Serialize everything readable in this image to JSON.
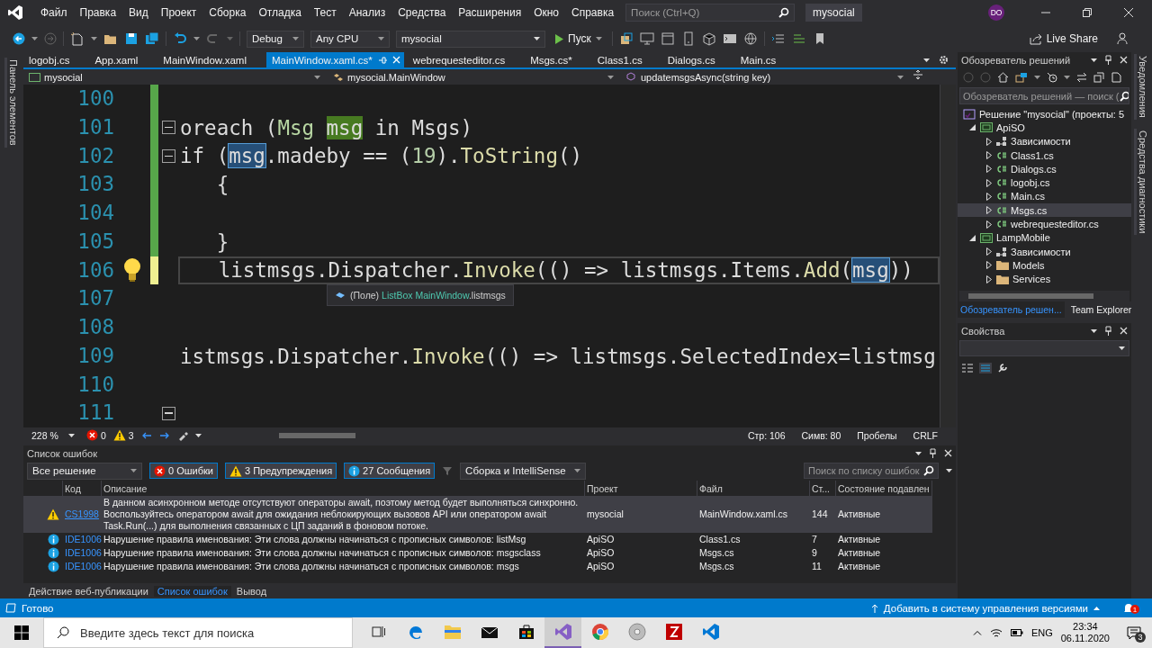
{
  "menu": [
    "Файл",
    "Правка",
    "Вид",
    "Проект",
    "Сборка",
    "Отладка",
    "Тест",
    "Анализ",
    "Средства",
    "Расширения",
    "Окно",
    "Справка"
  ],
  "search": {
    "placeholder": "Поиск (Ctrl+Q)"
  },
  "solution_name": "mysocial",
  "avatar": "DO",
  "toolbar": {
    "configuration": "Debug",
    "platform": "Any CPU",
    "startup_project": "mysocial",
    "run": "Пуск",
    "live_share": "Live Share"
  },
  "toolbox_tab": "Панель элементов",
  "doc_tabs": [
    {
      "label": "logobj.cs",
      "selected": false
    },
    {
      "label": "App.xaml",
      "selected": false
    },
    {
      "label": "MainWindow.xaml",
      "selected": false
    },
    {
      "label": "MainWindow.xaml.cs*",
      "selected": true
    },
    {
      "label": "webrequesteditor.cs",
      "selected": false
    },
    {
      "label": "Msgs.cs*",
      "selected": false
    },
    {
      "label": "Class1.cs",
      "selected": false
    },
    {
      "label": "Dialogs.cs",
      "selected": false
    },
    {
      "label": "Main.cs",
      "selected": false
    }
  ],
  "nav_bar": {
    "project": "mysocial",
    "type": "mysocial.MainWindow",
    "member": "updatemsgsAsync(string key)"
  },
  "editor": {
    "lines": [
      {
        "number": "100",
        "modified": true,
        "saved": true,
        "fold": false
      },
      {
        "number": "101",
        "modified": true,
        "saved": true,
        "fold": true,
        "segments": [
          {
            "text": "oreach (",
            "kind": "plain"
          },
          {
            "text": "Msg ",
            "kind": "type"
          },
          {
            "text": "msg",
            "kind": "definition"
          },
          {
            "text": " in Msgs)",
            "kind": "plain"
          }
        ]
      },
      {
        "number": "102",
        "modified": true,
        "saved": true,
        "fold": true,
        "segments": [
          {
            "text": "if (",
            "kind": "plain"
          },
          {
            "text": "msg",
            "kind": "reference"
          },
          {
            "text": ".madeby == (",
            "kind": "plain"
          },
          {
            "text": "19",
            "kind": "number"
          },
          {
            "text": ").",
            "kind": "plain"
          },
          {
            "text": "ToString",
            "kind": "method"
          },
          {
            "text": "()",
            "kind": "plain"
          }
        ]
      },
      {
        "number": "103",
        "modified": true,
        "saved": true,
        "fold": false,
        "segments": [
          {
            "text": "   {",
            "kind": "plain"
          }
        ]
      },
      {
        "number": "104",
        "modified": true,
        "saved": true,
        "fold": false
      },
      {
        "number": "105",
        "modified": true,
        "saved": true,
        "fold": false,
        "segments": [
          {
            "text": "   }",
            "kind": "plain"
          }
        ]
      },
      {
        "number": "106",
        "modified": true,
        "saved": false,
        "fold": false,
        "lightbulb": true,
        "current": true,
        "segments": [
          {
            "text": "   listmsgs.Dispatcher.",
            "kind": "plain"
          },
          {
            "text": "Invoke",
            "kind": "method"
          },
          {
            "text": "(() => listmsgs.Items.",
            "kind": "plain"
          },
          {
            "text": "Add",
            "kind": "method"
          },
          {
            "text": "(",
            "kind": "plain"
          },
          {
            "text": "msg",
            "kind": "reference"
          },
          {
            "text": "))",
            "kind": "plain"
          }
        ]
      },
      {
        "number": "107",
        "modified": false,
        "fold": false
      },
      {
        "number": "108",
        "modified": false,
        "fold": false
      },
      {
        "number": "109",
        "modified": false,
        "fold": false,
        "segments": [
          {
            "text": "istmsgs.Dispatcher.",
            "kind": "plain"
          },
          {
            "text": "Invoke",
            "kind": "method"
          },
          {
            "text": "(() => listmsgs.SelectedIndex=listmsg",
            "kind": "plain"
          }
        ]
      },
      {
        "number": "110",
        "modified": false,
        "fold": false
      },
      {
        "number": "111",
        "modified": false,
        "fold": true
      }
    ],
    "tooltip": {
      "segments": [
        {
          "text": "(Поле) ",
          "kind": "plain"
        },
        {
          "text": "ListBox MainWindow",
          "kind": "type"
        },
        {
          "text": ".listmsgs",
          "kind": "plain"
        }
      ]
    },
    "status": {
      "zoom": "228 %",
      "errors": "0",
      "warnings": "3",
      "line": "Стр: 106",
      "column": "Симв: 80",
      "indent": "Пробелы",
      "eol": "CRLF"
    }
  },
  "error_list": {
    "title": "Список ошибок",
    "scope": "Все решение",
    "filters": [
      {
        "kind": "error",
        "label": "0 Ошибки",
        "on": true
      },
      {
        "kind": "warning",
        "label": "3 Предупреждения",
        "on": true
      },
      {
        "kind": "info",
        "label": "27 Сообщения",
        "on": true
      }
    ],
    "source": "Сборка и IntelliSense",
    "search_placeholder": "Поиск по списку ошибок",
    "columns": [
      "Код",
      "Описание",
      "Проект",
      "Файл",
      "Ст...",
      "Состояние подавлен"
    ],
    "rows": [
      {
        "kind": "warning",
        "code": "CS1998",
        "description": "В данном асинхронном методе отсутствуют операторы await, поэтому метод будет выполняться синхронно. Воспользуйтесь оператором await для ожидания неблокирующих вызовов API или оператором await Task.Run(...) для выполнения связанных с ЦП заданий в фоновом потоке.",
        "project": "mysocial",
        "file": "MainWindow.xaml.cs",
        "line": "144",
        "state": "Активные",
        "selected": true
      },
      {
        "kind": "info",
        "code": "IDE1006",
        "description": "Нарушение правила именования: Эти слова должны начинаться с прописных символов: listMsg",
        "project": "ApiSO",
        "file": "Class1.cs",
        "line": "7",
        "state": "Активные",
        "selected": false
      },
      {
        "kind": "info",
        "code": "IDE1006",
        "description": "Нарушение правила именования: Эти слова должны начинаться с прописных символов: msgsclass",
        "project": "ApiSO",
        "file": "Msgs.cs",
        "line": "9",
        "state": "Активные",
        "selected": false
      },
      {
        "kind": "info",
        "code": "IDE1006",
        "description": "Нарушение правила именования: Эти слова должны начинаться с прописных символов: msgs",
        "project": "ApiSO",
        "file": "Msgs.cs",
        "line": "11",
        "state": "Активные",
        "selected": false
      }
    ]
  },
  "tool_tabs": [
    {
      "label": "Действие веб-публикации",
      "selected": false
    },
    {
      "label": "Список ошибок",
      "selected": true
    },
    {
      "label": "Вывод",
      "selected": false
    }
  ],
  "solution_explorer": {
    "title": "Обозреватель решений",
    "search_placeholder": "Обозреватель решений — поиск (",
    "tree": [
      {
        "label": "Решение \"mysocial\" (проекты: 5",
        "kind": "solution",
        "selected": false,
        "children": [
          {
            "label": "ApiSO",
            "kind": "project",
            "expanded": true,
            "selected": false,
            "children": [
              {
                "label": "Зависимости",
                "kind": "dependencies",
                "expanded": false,
                "selected": false
              },
              {
                "label": "Class1.cs",
                "kind": "file",
                "expanded": false,
                "selected": false
              },
              {
                "label": "Dialogs.cs",
                "kind": "file",
                "expanded": false,
                "selected": false
              },
              {
                "label": "logobj.cs",
                "kind": "file",
                "expanded": false,
                "selected": false
              },
              {
                "label": "Main.cs",
                "kind": "file",
                "expanded": false,
                "selected": false
              },
              {
                "label": "Msgs.cs",
                "kind": "file",
                "expanded": false,
                "selected": true
              },
              {
                "label": "webrequesteditor.cs",
                "kind": "file",
                "expanded": false,
                "selected": false
              }
            ]
          },
          {
            "label": "LampMobile",
            "kind": "project",
            "expanded": true,
            "selected": false,
            "children": [
              {
                "label": "Зависимости",
                "kind": "dependencies",
                "expanded": false,
                "selected": false
              },
              {
                "label": "Models",
                "kind": "folder",
                "expanded": false,
                "selected": false
              },
              {
                "label": "Services",
                "kind": "folder",
                "expanded": false,
                "selected": false
              }
            ]
          }
        ]
      }
    ],
    "tabs": [
      {
        "label": "Обозреватель решен...",
        "selected": true
      },
      {
        "label": "Team Explorer",
        "selected": false
      }
    ]
  },
  "properties": {
    "title": "Свойства"
  },
  "right_rail": [
    "Уведомления",
    "Средства диагностики"
  ],
  "status_bar": {
    "text": "Готово",
    "source_control": "Добавить в систему управления версиями",
    "notifications": "1"
  },
  "taskbar": {
    "search_placeholder": "Введите здесь текст для поиска",
    "apps": [
      {
        "kind": "taskview",
        "active": false
      },
      {
        "kind": "edge",
        "active": false
      },
      {
        "kind": "explorer",
        "active": false
      },
      {
        "kind": "mail",
        "active": false
      },
      {
        "kind": "store",
        "active": false
      },
      {
        "kind": "vs",
        "active": true
      },
      {
        "kind": "chrome",
        "active": false
      },
      {
        "kind": "disc",
        "active": false
      },
      {
        "kind": "filezilla",
        "active": false
      },
      {
        "kind": "vscode",
        "active": false
      }
    ],
    "language": "ENG",
    "time": "23:34",
    "date": "06.11.2020",
    "notifications": "3"
  }
}
